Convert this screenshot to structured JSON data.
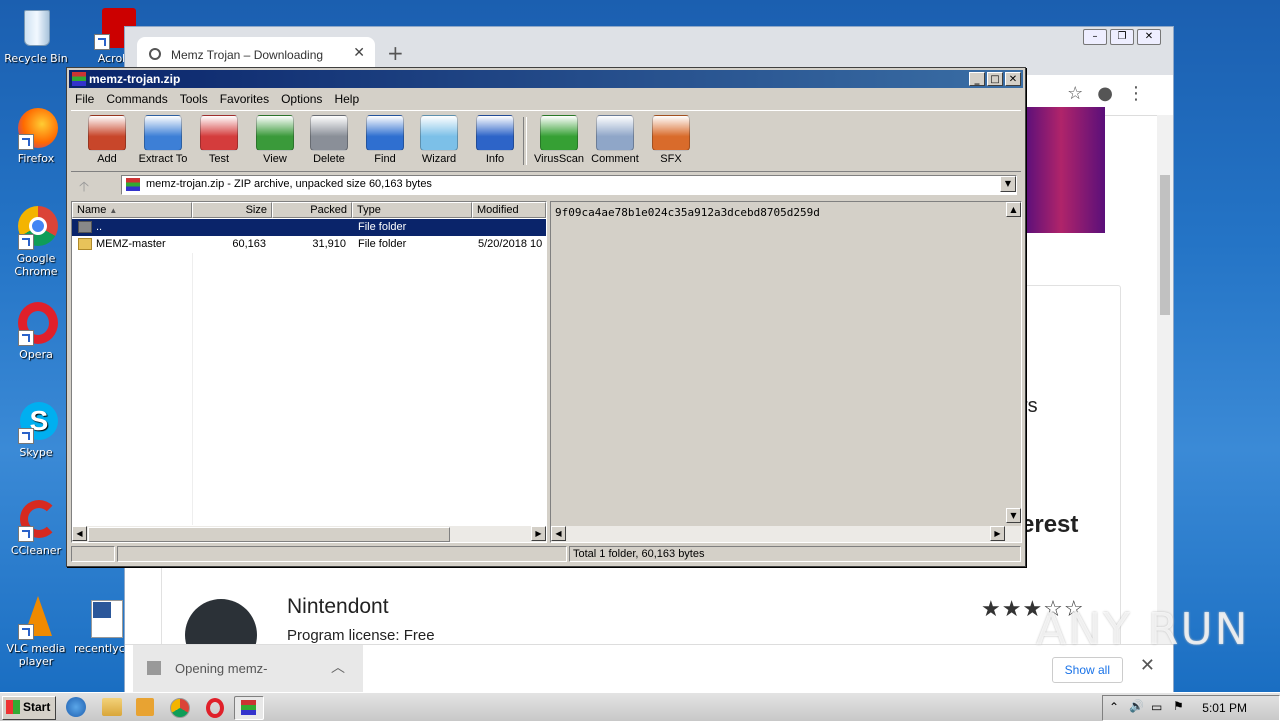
{
  "desktop": {
    "icons": [
      {
        "label": "Recycle Bin"
      },
      {
        "label": "Acrobat"
      },
      {
        "label": "Firefox"
      },
      {
        "label": "Google Chrome"
      },
      {
        "label": "Opera"
      },
      {
        "label": "Skype"
      },
      {
        "label": "CCleaner"
      },
      {
        "label": "VLC media player"
      },
      {
        "label": "recentlyc"
      }
    ]
  },
  "browser": {
    "tab_title": "Memz Trojan – Downloading",
    "tab_close": "✕",
    "new_tab": "+",
    "frag_rs": "rs",
    "frag_erest": "erest",
    "app_name": "Nintendont",
    "app_license": "Program license: Free",
    "rating_stars": "★★★☆☆",
    "download_item": "Opening memz-",
    "show_all": "Show all",
    "download_close": "✕"
  },
  "winrar": {
    "title": "memz-trojan.zip",
    "menu": [
      "File",
      "Commands",
      "Tools",
      "Favorites",
      "Options",
      "Help"
    ],
    "toolbar": [
      {
        "label": "Add",
        "icon": "add-archive-icon",
        "color": "#c8462a"
      },
      {
        "label": "Extract To",
        "icon": "folder-extract-icon",
        "color": "#3d7fd6"
      },
      {
        "label": "Test",
        "icon": "test-clipboard-icon",
        "color": "#d43c3c"
      },
      {
        "label": "View",
        "icon": "book-view-icon",
        "color": "#3a9a3a"
      },
      {
        "label": "Delete",
        "icon": "trash-icon",
        "color": "#8a8f98"
      },
      {
        "label": "Find",
        "icon": "magnifier-icon",
        "color": "#2f6fd0"
      },
      {
        "label": "Wizard",
        "icon": "wand-icon",
        "color": "#7cc0e8"
      },
      {
        "label": "Info",
        "icon": "info-icon",
        "color": "#2d64c8"
      },
      {
        "label": "VirusScan",
        "icon": "virus-icon",
        "color": "#36a034"
      },
      {
        "label": "Comment",
        "icon": "comment-icon",
        "color": "#8fa6c8"
      },
      {
        "label": "SFX",
        "icon": "sfx-books-icon",
        "color": "#d96b2b"
      }
    ],
    "address": "memz-trojan.zip - ZIP archive, unpacked size 60,163 bytes",
    "columns": {
      "name": "Name",
      "size": "Size",
      "packed": "Packed",
      "type": "Type",
      "modified": "Modified"
    },
    "rows": [
      {
        "name": "..",
        "size": "",
        "packed": "",
        "type": "File folder",
        "modified": ""
      },
      {
        "name": "MEMZ-master",
        "size": "60,163",
        "packed": "31,910",
        "type": "File folder",
        "modified": "5/20/2018 10"
      }
    ],
    "info_hash": "9f09ca4ae78b1e024c35a912a3dcebd8705d259d",
    "status_text": "Total 1 folder, 60,163 bytes"
  },
  "taskbar": {
    "start_label": "Start",
    "clock": "5:01 PM"
  },
  "watermark": "ANY RUN"
}
